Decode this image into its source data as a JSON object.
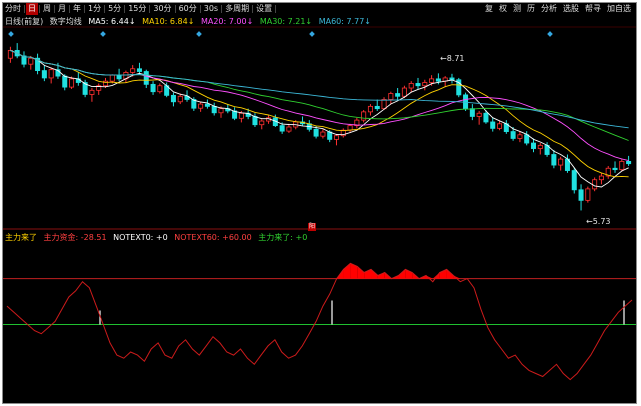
{
  "toolbar": {
    "items": [
      {
        "label": "分时",
        "active": false
      },
      {
        "label": "日",
        "active": true
      },
      {
        "label": "周",
        "active": false
      },
      {
        "label": "月",
        "active": false
      },
      {
        "label": "年",
        "active": false
      },
      {
        "label": "1分",
        "active": false
      },
      {
        "label": "5分",
        "active": false
      },
      {
        "label": "15分",
        "active": false
      },
      {
        "label": "30分",
        "active": false
      },
      {
        "label": "60分",
        "active": false
      },
      {
        "label": "30s",
        "active": false
      },
      {
        "label": "多周期",
        "active": false
      },
      {
        "label": "设置",
        "active": false
      }
    ],
    "right_items": [
      "复",
      "权",
      "测",
      "历",
      "分析",
      "选股",
      "帮寻",
      "加自选"
    ]
  },
  "legend": {
    "prefix": "日线(前复)",
    "indicator_name": "数字均线",
    "ma5": "MA5: 6.44↓",
    "ma10": "MA10: 6.84↓",
    "ma20": "MA20: 7.00↓",
    "ma30": "MA30: 7.21↓",
    "ma60": "MA60: 7.77↓"
  },
  "price_labels": {
    "high": "8.71",
    "low": "5.73"
  },
  "indicator_legend": {
    "l1": "主力来了",
    "l2": "主力资金: -28.51",
    "l3": "NOTEXT0: +0",
    "l4": "NOTEXT60: +60.00",
    "l5": "主力来了: +0"
  },
  "marker": "阳",
  "colors": {
    "up": "#ff3030",
    "down": "#20e0e0",
    "ma5": "#ffffff",
    "ma10": "#ffd200",
    "ma20": "#ff50ff",
    "ma30": "#30d030",
    "ma60": "#3cb8d8",
    "indicator_line": "#cc1b1b",
    "fill": "#ff0000",
    "green_line": "#20c030"
  },
  "chart_data": {
    "type": "line",
    "candles": [
      [
        9.05,
        9.3,
        8.95,
        9.22
      ],
      [
        9.22,
        9.38,
        9.05,
        9.1
      ],
      [
        9.1,
        9.2,
        8.85,
        8.92
      ],
      [
        8.92,
        9.1,
        8.8,
        9.05
      ],
      [
        9.05,
        9.15,
        8.7,
        8.78
      ],
      [
        8.78,
        8.9,
        8.55,
        8.62
      ],
      [
        8.62,
        8.85,
        8.5,
        8.8
      ],
      [
        8.8,
        8.95,
        8.6,
        8.66
      ],
      [
        8.66,
        8.7,
        8.35,
        8.42
      ],
      [
        8.42,
        8.65,
        8.38,
        8.6
      ],
      [
        8.6,
        8.75,
        8.45,
        8.52
      ],
      [
        8.52,
        8.58,
        8.2,
        8.26
      ],
      [
        8.26,
        8.4,
        8.1,
        8.35
      ],
      [
        8.35,
        8.5,
        8.25,
        8.45
      ],
      [
        8.45,
        8.62,
        8.4,
        8.55
      ],
      [
        8.55,
        8.7,
        8.5,
        8.68
      ],
      [
        8.68,
        8.82,
        8.55,
        8.6
      ],
      [
        8.6,
        8.78,
        8.52,
        8.74
      ],
      [
        8.74,
        8.9,
        8.65,
        8.82
      ],
      [
        8.82,
        8.95,
        8.7,
        8.76
      ],
      [
        8.76,
        8.8,
        8.4,
        8.48
      ],
      [
        8.48,
        8.55,
        8.25,
        8.32
      ],
      [
        8.32,
        8.5,
        8.28,
        8.45
      ],
      [
        8.45,
        8.52,
        8.2,
        8.24
      ],
      [
        8.24,
        8.3,
        8.0,
        8.1
      ],
      [
        8.1,
        8.28,
        8.05,
        8.22
      ],
      [
        8.22,
        8.35,
        8.1,
        8.15
      ],
      [
        8.15,
        8.2,
        7.9,
        7.96
      ],
      [
        7.96,
        8.1,
        7.88,
        8.05
      ],
      [
        8.05,
        8.15,
        7.95,
        8.0
      ],
      [
        8.0,
        8.08,
        7.8,
        7.86
      ],
      [
        7.86,
        8.0,
        7.75,
        7.95
      ],
      [
        7.95,
        8.05,
        7.85,
        7.9
      ],
      [
        7.9,
        7.98,
        7.7,
        7.74
      ],
      [
        7.74,
        7.9,
        7.65,
        7.85
      ],
      [
        7.85,
        7.95,
        7.72,
        7.78
      ],
      [
        7.78,
        7.85,
        7.55,
        7.6
      ],
      [
        7.6,
        7.72,
        7.5,
        7.68
      ],
      [
        7.68,
        7.8,
        7.62,
        7.75
      ],
      [
        7.75,
        7.82,
        7.55,
        7.58
      ],
      [
        7.58,
        7.65,
        7.4,
        7.46
      ],
      [
        7.46,
        7.62,
        7.42,
        7.55
      ],
      [
        7.55,
        7.7,
        7.5,
        7.66
      ],
      [
        7.66,
        7.78,
        7.58,
        7.62
      ],
      [
        7.62,
        7.7,
        7.45,
        7.5
      ],
      [
        7.5,
        7.58,
        7.3,
        7.35
      ],
      [
        7.35,
        7.5,
        7.3,
        7.44
      ],
      [
        7.44,
        7.48,
        7.22,
        7.28
      ],
      [
        7.28,
        7.4,
        7.15,
        7.36
      ],
      [
        7.36,
        7.52,
        7.32,
        7.48
      ],
      [
        7.48,
        7.62,
        7.42,
        7.58
      ],
      [
        7.58,
        7.75,
        7.52,
        7.7
      ],
      [
        7.7,
        7.92,
        7.65,
        7.88
      ],
      [
        7.88,
        8.05,
        7.8,
        8.0
      ],
      [
        8.0,
        8.15,
        7.9,
        7.95
      ],
      [
        7.95,
        8.2,
        7.92,
        8.15
      ],
      [
        8.15,
        8.32,
        8.05,
        8.28
      ],
      [
        8.28,
        8.4,
        8.15,
        8.22
      ],
      [
        8.22,
        8.45,
        8.18,
        8.4
      ],
      [
        8.4,
        8.55,
        8.3,
        8.5
      ],
      [
        8.5,
        8.62,
        8.38,
        8.45
      ],
      [
        8.45,
        8.58,
        8.35,
        8.52
      ],
      [
        8.52,
        8.68,
        8.45,
        8.6
      ],
      [
        8.6,
        8.72,
        8.48,
        8.55
      ],
      [
        8.55,
        8.66,
        8.42,
        8.62
      ],
      [
        8.62,
        8.71,
        8.5,
        8.58
      ],
      [
        8.58,
        8.62,
        8.2,
        8.25
      ],
      [
        8.25,
        8.3,
        7.9,
        7.95
      ],
      [
        7.95,
        8.05,
        7.7,
        7.78
      ],
      [
        7.78,
        7.9,
        7.6,
        7.85
      ],
      [
        7.85,
        7.92,
        7.62,
        7.66
      ],
      [
        7.66,
        7.75,
        7.45,
        7.52
      ],
      [
        7.52,
        7.68,
        7.48,
        7.62
      ],
      [
        7.62,
        7.7,
        7.4,
        7.45
      ],
      [
        7.45,
        7.55,
        7.25,
        7.3
      ],
      [
        7.3,
        7.45,
        7.22,
        7.38
      ],
      [
        7.38,
        7.46,
        7.15,
        7.2
      ],
      [
        7.2,
        7.3,
        7.0,
        7.08
      ],
      [
        7.08,
        7.2,
        6.95,
        7.15
      ],
      [
        7.15,
        7.22,
        6.9,
        6.95
      ],
      [
        6.95,
        7.05,
        6.65,
        6.72
      ],
      [
        6.72,
        6.9,
        6.6,
        6.85
      ],
      [
        6.85,
        6.95,
        6.55,
        6.6
      ],
      [
        6.6,
        6.65,
        6.1,
        6.18
      ],
      [
        6.18,
        6.3,
        5.73,
        5.95
      ],
      [
        5.95,
        6.25,
        5.9,
        6.2
      ],
      [
        6.2,
        6.45,
        6.15,
        6.4
      ],
      [
        6.4,
        6.55,
        6.3,
        6.48
      ],
      [
        6.48,
        6.7,
        6.42,
        6.65
      ],
      [
        6.65,
        6.8,
        6.55,
        6.62
      ],
      [
        6.62,
        6.85,
        6.58,
        6.8
      ],
      [
        6.8,
        6.92,
        6.7,
        6.75
      ]
    ],
    "indicator_series": [
      62,
      58,
      54,
      50,
      46,
      44,
      48,
      52,
      60,
      68,
      72,
      78,
      74,
      62,
      50,
      38,
      30,
      28,
      32,
      30,
      26,
      34,
      38,
      30,
      28,
      36,
      40,
      34,
      30,
      36,
      42,
      38,
      32,
      30,
      34,
      28,
      24,
      30,
      36,
      40,
      32,
      28,
      30,
      36,
      44,
      52,
      62,
      70,
      80,
      86,
      90,
      88,
      84,
      86,
      82,
      84,
      80,
      82,
      86,
      84,
      80,
      82,
      78,
      84,
      86,
      82,
      78,
      80,
      74,
      60,
      48,
      40,
      34,
      28,
      30,
      24,
      20,
      18,
      16,
      20,
      24,
      18,
      14,
      18,
      24,
      30,
      38,
      46,
      52,
      58,
      62,
      66
    ],
    "indicator_ylim": [
      0,
      100
    ],
    "price_ylim": [
      5.5,
      9.6
    ]
  }
}
